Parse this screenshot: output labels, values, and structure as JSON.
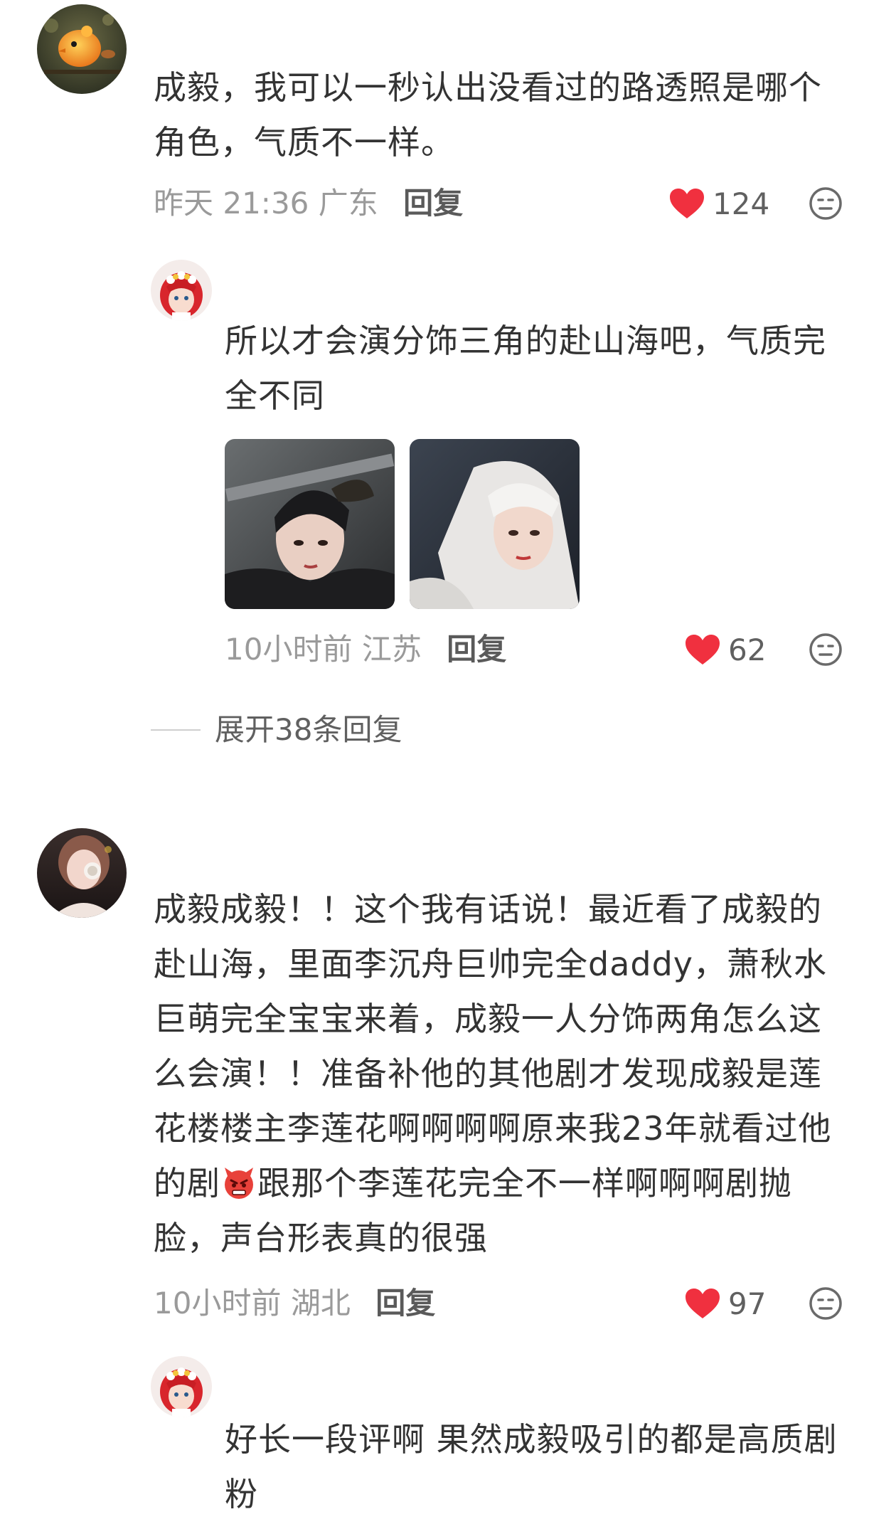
{
  "comments": [
    {
      "avatar_icon": "bird-avatar-icon",
      "lines": [
        "成毅，我可以一秒认出没看过的路透照是哪个",
        "角色，气质不一样。"
      ],
      "time": "昨天 21:36",
      "region": "广东",
      "reply_label": "回复",
      "likes": "124",
      "replies": [
        {
          "avatar_icon": "anime-girl-avatar-icon",
          "lines": [
            "所以才会演分饰三角的赴山海吧，气质完",
            "全不同"
          ],
          "images": [
            "dark-hair-swordsman-photo",
            "white-hair-actor-photo"
          ],
          "time": "10小时前",
          "region": "江苏",
          "reply_label": "回复",
          "likes": "62"
        }
      ],
      "expand_label": "展开38条回复"
    },
    {
      "avatar_icon": "girl-photo-avatar-icon",
      "lines": [
        "成毅成毅！！这个我有话说！最近看了成毅的",
        "赴山海，里面李沉舟巨帅完全daddy，萧秋水",
        "巨萌完全宝宝来着，成毅一人分饰两角怎么这",
        "么会演！！准备补他的其他剧才发现成毅是莲",
        "花楼楼主李莲花啊啊啊啊原来我23年就看过他"
      ],
      "line6_before": "的剧",
      "line6_emoji": "angry-face-emoji-icon",
      "line6_after": "跟那个李莲花完全不一样啊啊啊剧抛",
      "line7": "脸，声台形表真的很强",
      "time": "10小时前",
      "region": "湖北",
      "reply_label": "回复",
      "likes": "97",
      "replies": [
        {
          "avatar_icon": "anime-girl-avatar-icon",
          "lines": [
            "好长一段评啊 果然成毅吸引的都是高质剧",
            "粉"
          ]
        }
      ]
    }
  ],
  "colors": {
    "heart": "#f0303f",
    "text": "#333333",
    "meta": "#9a9a9a",
    "reply": "#5a5a5a"
  }
}
